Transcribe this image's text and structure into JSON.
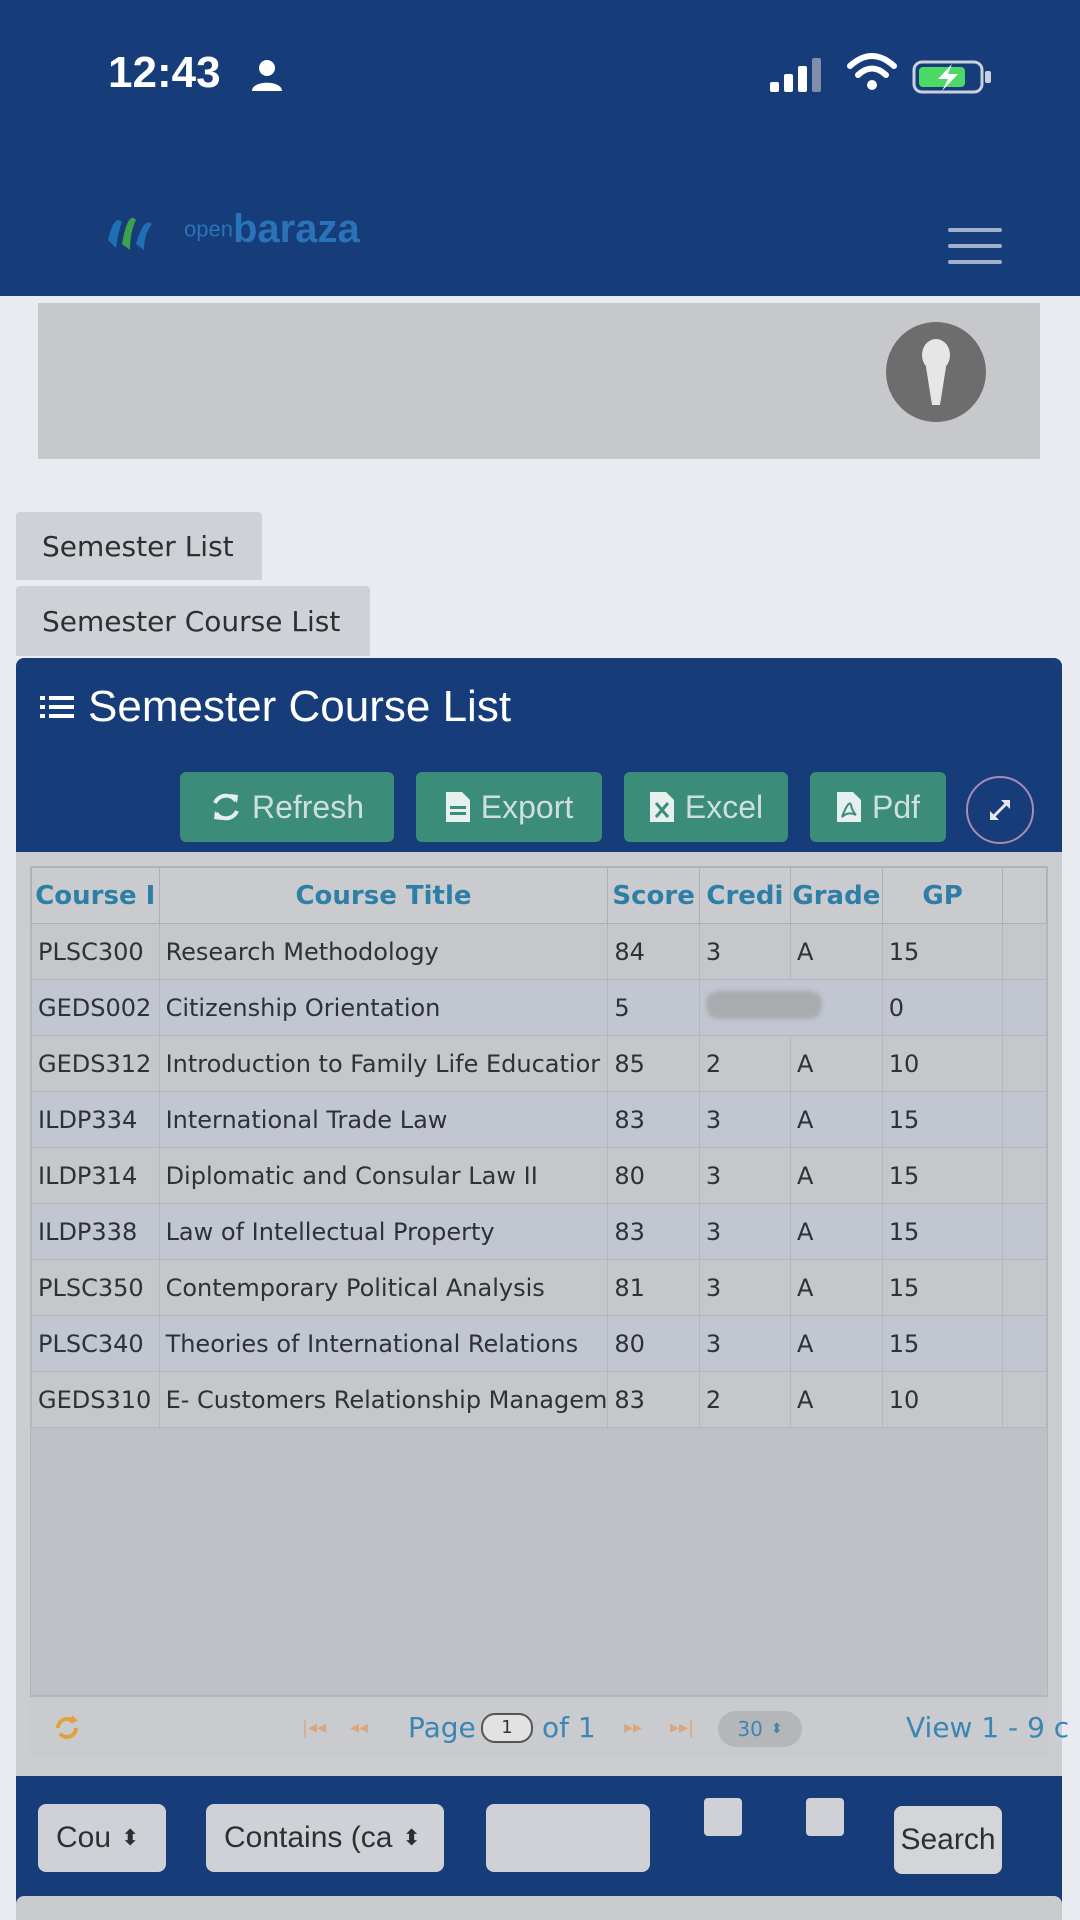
{
  "status_bar": {
    "time": "12:43"
  },
  "header": {
    "logo_prefix": "open",
    "logo_name": "baraza"
  },
  "tabs": [
    {
      "label": "Semester List"
    },
    {
      "label": "Semester Course List"
    }
  ],
  "panel": {
    "title": "Semester Course List",
    "buttons": {
      "refresh": "Refresh",
      "export": "Export",
      "excel": "Excel",
      "pdf": "Pdf"
    }
  },
  "table": {
    "columns": [
      "Course I",
      "Course Title",
      "Score",
      "Credi",
      "Grade",
      "GP"
    ],
    "rows": [
      [
        "PLSC300",
        "Research Methodology",
        "84",
        "3",
        "A",
        "15"
      ],
      [
        "GEDS002",
        "Citizenship Orientation",
        "5",
        "",
        "",
        "0"
      ],
      [
        "GEDS312",
        "Introduction to Family Life Educatior",
        "85",
        "2",
        "A",
        "10"
      ],
      [
        "ILDP334",
        "International Trade Law",
        "83",
        "3",
        "A",
        "15"
      ],
      [
        "ILDP314",
        "Diplomatic and Consular Law II",
        "80",
        "3",
        "A",
        "15"
      ],
      [
        "ILDP338",
        "Law of Intellectual Property",
        "83",
        "3",
        "A",
        "15"
      ],
      [
        "PLSC350",
        "Contemporary Political Analysis",
        "81",
        "3",
        "A",
        "15"
      ],
      [
        "PLSC340",
        "Theories of International Relations",
        "80",
        "3",
        "A",
        "15"
      ],
      [
        "GEDS310",
        "E- Customers Relationship Managem",
        "83",
        "2",
        "A",
        "10"
      ]
    ]
  },
  "pager": {
    "page_label": "Page",
    "page_value": "1",
    "of_label": "of 1",
    "rows_per_page": "30",
    "view_label": "View 1 - 9 c"
  },
  "search": {
    "field": "Cou",
    "operator": "Contains (ca",
    "button": "Search"
  },
  "colors": {
    "header_bg": "#163c79",
    "button_bg": "#3b8c79",
    "link_blue": "#3a86b4"
  }
}
